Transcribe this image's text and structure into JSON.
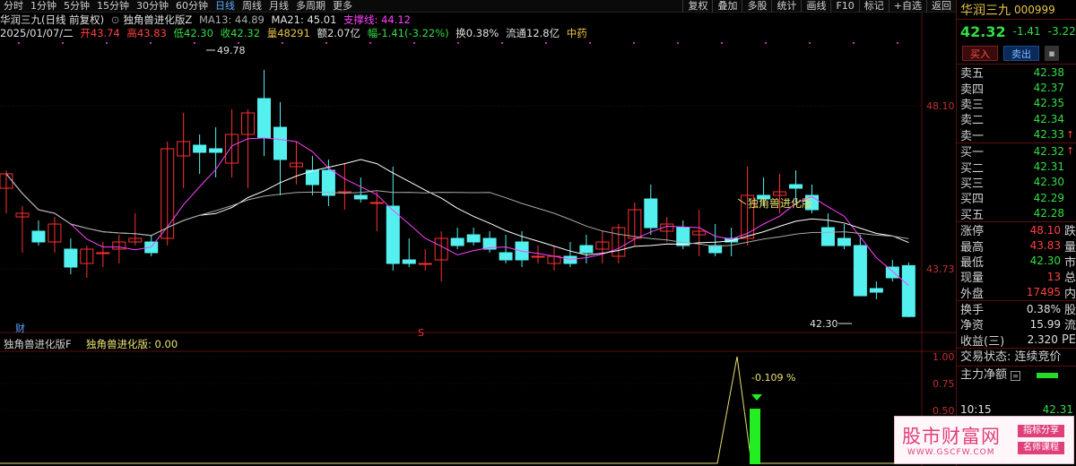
{
  "toolbar": {
    "periods": [
      "分时",
      "1分钟",
      "5分钟",
      "15分钟",
      "30分钟",
      "60分钟",
      "日线",
      "周线",
      "月线",
      "多周期",
      "更多"
    ],
    "active_period": "日线",
    "tools": [
      "复权",
      "叠加",
      "多股",
      "统计",
      "画线",
      "F10",
      "标记",
      "+自选",
      "返回"
    ]
  },
  "info": {
    "title": "华润三九(日线 前复权)",
    "indicator_name": "独角兽进化版Z",
    "ma13": "MA13: 44.89",
    "ma21": "MA21: 45.01",
    "support": "支撑线: 44.12",
    "date": "2025/01/07/二",
    "open": "开43.74",
    "high": "高43.83",
    "low": "低42.30",
    "close": "收42.32",
    "volume": "量48291",
    "amount": "额2.07亿",
    "change": "幅-1.41(-3.22%)",
    "turnover": "换0.38%",
    "float": "流通12.8亿",
    "sector": "中药"
  },
  "price_axis": [
    "48.10",
    "43.73"
  ],
  "annotations": {
    "peak": "49.78",
    "low": "42.30",
    "indicator_tag": "独角兽进化版",
    "cai": "财",
    "s_mark": "S"
  },
  "sub": {
    "title": "独角兽进化版F",
    "value_text": "独角兽进化版: 0.00",
    "axis": [
      "1.00",
      "0.75",
      "0.50"
    ],
    "pct_label": "-0.109  %"
  },
  "chart_data": {
    "type": "candlestick",
    "sessions": 56,
    "last_bar": {
      "date": "2025/01/07",
      "open": 43.74,
      "high": 43.83,
      "low": 42.3,
      "close": 42.32,
      "volume": 48291
    },
    "ma13_last": 44.89,
    "ma21_last": 45.01,
    "support_last": 44.12,
    "peak": 49.78,
    "price_ticks": [
      48.1,
      43.73
    ],
    "indicator_axis_ticks": [
      1.0,
      0.75,
      0.5
    ],
    "indicator_value": 0.0
  },
  "panel": {
    "name": "华润三九",
    "code": "000999",
    "price": "42.32",
    "change": "-1.41",
    "change_pct": "-3.22%",
    "buy_label": "买入",
    "sell_label": "卖出",
    "asks": [
      {
        "label": "卖五",
        "price": "42.38",
        "arrow": ""
      },
      {
        "label": "卖四",
        "price": "42.37",
        "arrow": ""
      },
      {
        "label": "卖三",
        "price": "42.35",
        "arrow": ""
      },
      {
        "label": "卖二",
        "price": "42.34",
        "arrow": ""
      },
      {
        "label": "卖一",
        "price": "42.33",
        "arrow": "↑"
      }
    ],
    "bids": [
      {
        "label": "买一",
        "price": "42.32",
        "arrow": "↑"
      },
      {
        "label": "买二",
        "price": "42.31",
        "arrow": ""
      },
      {
        "label": "买三",
        "price": "42.30",
        "arrow": ""
      },
      {
        "label": "买四",
        "price": "42.29",
        "arrow": ""
      },
      {
        "label": "买五",
        "price": "42.28",
        "arrow": ""
      }
    ],
    "stats1": [
      {
        "label": "涨停",
        "value": "48.10",
        "tail": "跌",
        "color": "red"
      },
      {
        "label": "最高",
        "value": "43.83",
        "tail": "量",
        "color": "red"
      },
      {
        "label": "最低",
        "value": "42.30",
        "tail": "市",
        "color": "green"
      },
      {
        "label": "现量",
        "value": "13",
        "tail": "总",
        "color": "red"
      },
      {
        "label": "外盘",
        "value": "17495",
        "tail": "内",
        "color": "red"
      }
    ],
    "stats2": [
      {
        "label": "换手",
        "value": "0.38%",
        "tail": "股",
        "color": "white"
      },
      {
        "label": "净资",
        "value": "15.99",
        "tail": "流",
        "color": "white"
      },
      {
        "label": "收益(三)",
        "value": "2.320",
        "tail": "PE",
        "color": "white"
      }
    ],
    "status": "交易状态: 连续竞价",
    "netflow": "主力净额",
    "time": "10:15",
    "time_price": "42.31"
  },
  "watermark": {
    "title": "股市财富网",
    "url": "WWW.GSCFW.COM",
    "tag1": "指标分享",
    "tag2": "名师课程"
  },
  "colors": {
    "up": "#ff3030",
    "down": "#54f0f0",
    "ma_white": "#ffffff",
    "ma_magenta": "#ff40ff",
    "ma_gray": "#a8a8a8",
    "indicator_green": "#22ee22",
    "indicator_line": "#e8e070"
  }
}
